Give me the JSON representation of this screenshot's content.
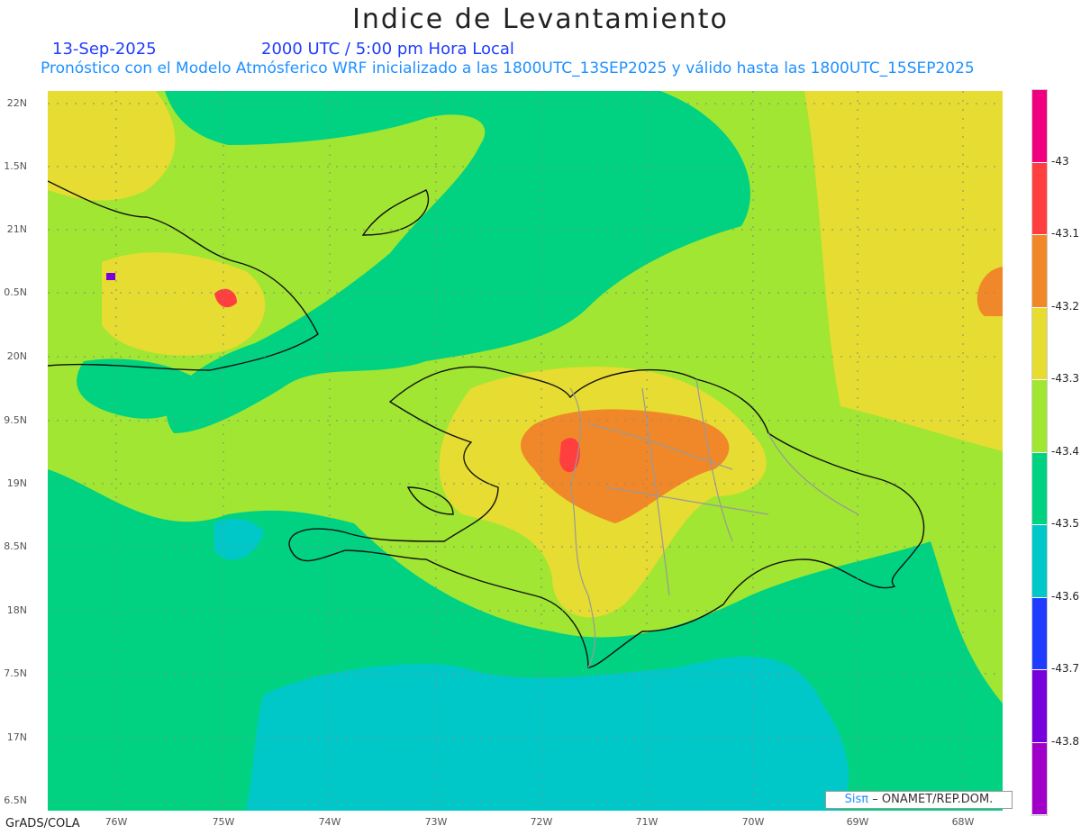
{
  "header": {
    "title": "Indice de Levantamiento",
    "date": "13-Sep-2025",
    "time": "2000 UTC / 5:00 pm Hora Local",
    "subtitle": "Pronóstico con el Modelo Atmósferico WRF inicializado a las 1800UTC_13SEP2025 y válido hasta las  1800UTC_15SEP2025"
  },
  "map": {
    "lat_labels": [
      "22N",
      "1.5N",
      "21N",
      "0.5N",
      "20N",
      "9.5N",
      "19N",
      "8.5N",
      "18N",
      "7.5N",
      "17N",
      "6.5N"
    ],
    "lon_labels": [
      "76W",
      "75W",
      "74W",
      "73W",
      "72W",
      "71W",
      "70W",
      "69W",
      "68W"
    ]
  },
  "colorbar": {
    "labels": [
      "-43",
      "-43.1",
      "-43.2",
      "-43.3",
      "-43.4",
      "-43.5",
      "-43.6",
      "-43.7",
      "-43.8"
    ],
    "colors": [
      "#f0007f",
      "#ff3f3f",
      "#f0882a",
      "#e6dc32",
      "#a0e632",
      "#00d282",
      "#00c8c8",
      "#1e3cff",
      "#7800dc",
      "#a000c8"
    ]
  },
  "footer": {
    "credit": "GrADS/COLA",
    "sis": "Sisπ",
    "agency": "– ONAMET/REP.DOM."
  }
}
